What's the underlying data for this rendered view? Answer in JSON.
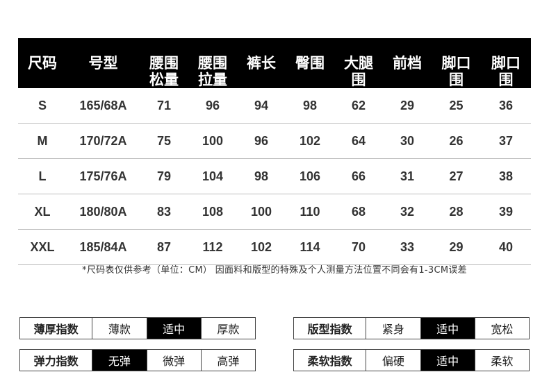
{
  "table": {
    "headers": [
      "尺码",
      "号型",
      "腰围\n松量",
      "腰围\n拉量",
      "裤长",
      "臀围",
      "大腿\n围",
      "前档",
      "脚口\n围",
      "脚口\n围"
    ],
    "rows": [
      [
        "S",
        "165/68A",
        "71",
        "96",
        "94",
        "98",
        "62",
        "29",
        "25",
        "36"
      ],
      [
        "M",
        "170/72A",
        "75",
        "100",
        "96",
        "102",
        "64",
        "30",
        "26",
        "37"
      ],
      [
        "L",
        "175/76A",
        "79",
        "104",
        "98",
        "106",
        "66",
        "31",
        "27",
        "38"
      ],
      [
        "XL",
        "180/80A",
        "83",
        "108",
        "100",
        "110",
        "68",
        "32",
        "28",
        "39"
      ],
      [
        "XXL",
        "185/84A",
        "87",
        "112",
        "102",
        "114",
        "70",
        "33",
        "29",
        "40"
      ]
    ]
  },
  "note": "*尺码表仅供参考（单位：CM） 因面料和版型的特殊及个人测量方法位置不同会有1-3CM误差",
  "ratings": [
    {
      "label": "薄厚指数",
      "options": [
        "薄款",
        "适中",
        "厚款"
      ],
      "selected": 1
    },
    {
      "label": "版型指数",
      "options": [
        "紧身",
        "适中",
        "宽松"
      ],
      "selected": 1
    },
    {
      "label": "弹力指数",
      "options": [
        "无弹",
        "微弹",
        "高弹"
      ],
      "selected": 0
    },
    {
      "label": "柔软指数",
      "options": [
        "偏硬",
        "适中",
        "柔软"
      ],
      "selected": 1
    }
  ],
  "colors": {
    "header_bg": "#000000",
    "selected_bg": "#000000",
    "text": "#222222"
  }
}
